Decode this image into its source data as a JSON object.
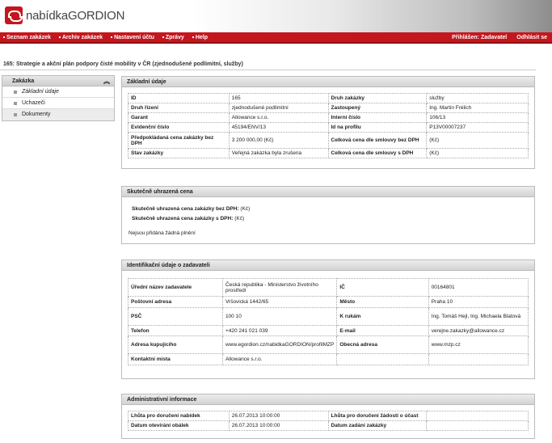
{
  "app": {
    "logo_text": "nabídkaGORDION"
  },
  "menu": {
    "items": [
      "Seznam zakázek",
      "Archiv zakázek",
      "Nastavení účtu",
      "Zprávy",
      "Help"
    ],
    "user": "Přihlášen: Zadavatel",
    "logout": "Odhlásit se"
  },
  "page": {
    "title": "165: Strategie a akční plán podpory čisté mobility v ČR (zjednodušené podlimitní, služby)"
  },
  "sidebar": {
    "header": "Zakázka",
    "items": [
      {
        "label": "Základní údaje"
      },
      {
        "label": "Uchazeči"
      },
      {
        "label": "Dokumenty"
      }
    ]
  },
  "basic": {
    "title": "Základní údaje",
    "rows": [
      [
        "ID",
        "165",
        "Druh zakázky",
        "služby"
      ],
      [
        "Druh řízení",
        "zjednodušené podlimitní",
        "Zastoupený",
        "Ing. Martin Frélich"
      ],
      [
        "Garant",
        "Allowance s.r.o.",
        "Interní číslo",
        "106/13"
      ],
      [
        "Evidenční číslo",
        "45194/ENV/13",
        "Id na profilu",
        "P13V00007237"
      ],
      [
        "Předpokládaná cena zakázky bez DPH",
        "3 200 000,00 (Kč)",
        "Celková cena dle smlouvy bez DPH",
        "(Kč)"
      ],
      [
        "Stav zakázky",
        "Veřejná zakázka byla zrušena",
        "Celková cena dle smlouvy s DPH",
        "(Kč)"
      ]
    ]
  },
  "paid": {
    "title": "Skutečně uhrazená cena",
    "without_vat_label": "Skutečně uhrazená cena zakázky bez DPH:",
    "without_vat_value": "(Kč)",
    "with_vat_label": "Skutečně uhrazená cena zakázky s DPH:",
    "with_vat_value": "(Kč)",
    "note": "Nejsou přidána žádná plnění"
  },
  "ident": {
    "title": "Identifikační údaje o zadavateli",
    "rows": [
      [
        "Úřední název zadavatele",
        "Česká republika - Ministerstvo životního prostředí",
        "IČ",
        "00164801"
      ],
      [
        "Poštovní adresa",
        "Vršovická 1442/65",
        "Město",
        "Praha 10"
      ],
      [
        "PSČ",
        "100 10",
        "K rukám",
        "Ing. Tomáš Hejl, Ing. Michaela Blatová"
      ],
      [
        "Telefon",
        "+420 241 021 039",
        "E-mail",
        "verejne.zakazky@allowance.cz"
      ],
      [
        "Adresa kupujícího",
        "www.egordion.cz/nabidkaGORDION/profilMZP",
        "Obecná adresa",
        "www.mzp.cz"
      ],
      [
        "Kontaktní místa",
        "Allowance s.r.o.",
        "",
        ""
      ]
    ]
  },
  "admin": {
    "title": "Administrativní informace",
    "rows": [
      [
        "Lhůta pro doručení nabídek",
        "26.07.2013 10:00:00",
        "Lhůta pro doručení žádostí o účast",
        ""
      ],
      [
        "Datum otevírání obálek",
        "26.07.2013 10:00:00",
        "Datum zadání zakázky",
        ""
      ]
    ]
  }
}
